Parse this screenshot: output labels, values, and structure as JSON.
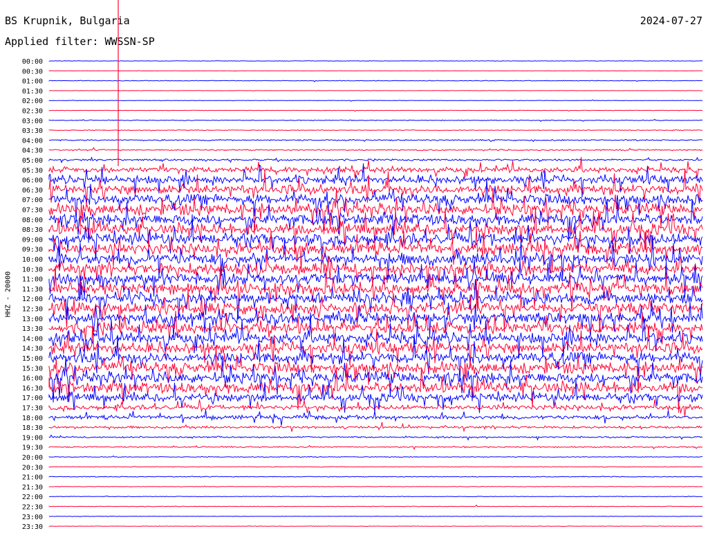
{
  "header": {
    "station": "BS Krupnik, Bulgaria",
    "date": "2024-07-27",
    "filter_label": "Applied filter: WWSSN-SP"
  },
  "channel_label": "HHZ - 20000",
  "colors": {
    "trace_a": "#0000ff",
    "trace_b": "#ff0033",
    "background": "#ffffff",
    "text": "#000000"
  },
  "chart_data": {
    "type": "line",
    "description": "helicorder: one trace per 30-minute interval",
    "row_labels": [
      "00:00",
      "00:30",
      "01:00",
      "01:30",
      "02:00",
      "02:30",
      "03:00",
      "03:30",
      "04:00",
      "04:30",
      "05:00",
      "05:30",
      "06:00",
      "06:30",
      "07:00",
      "07:30",
      "08:00",
      "08:30",
      "09:00",
      "09:30",
      "10:00",
      "10:30",
      "11:00",
      "11:30",
      "12:00",
      "12:30",
      "13:00",
      "13:30",
      "14:00",
      "14:30",
      "15:00",
      "15:30",
      "16:00",
      "16:30",
      "17:00",
      "17:30",
      "18:00",
      "18:30",
      "19:00",
      "19:30",
      "20:00",
      "20:30",
      "21:00",
      "21:30",
      "22:00",
      "22:30",
      "23:00",
      "23:30"
    ],
    "row_activity": [
      0.3,
      0.2,
      0.4,
      0.2,
      0.3,
      0.3,
      0.5,
      0.5,
      0.8,
      0.9,
      1.2,
      3.5,
      5,
      6,
      6.5,
      7,
      7,
      7,
      7,
      7,
      7,
      7,
      7,
      7,
      7,
      7,
      7,
      7,
      7,
      7,
      7,
      7,
      7,
      7,
      5,
      3,
      2.5,
      1.5,
      1,
      0.8,
      0.5,
      0.4,
      0.5,
      0.3,
      0.4,
      0.4,
      0.3,
      0.3
    ],
    "row_colors": [
      "blue",
      "red"
    ],
    "ylabel": "HHZ - 20000"
  }
}
